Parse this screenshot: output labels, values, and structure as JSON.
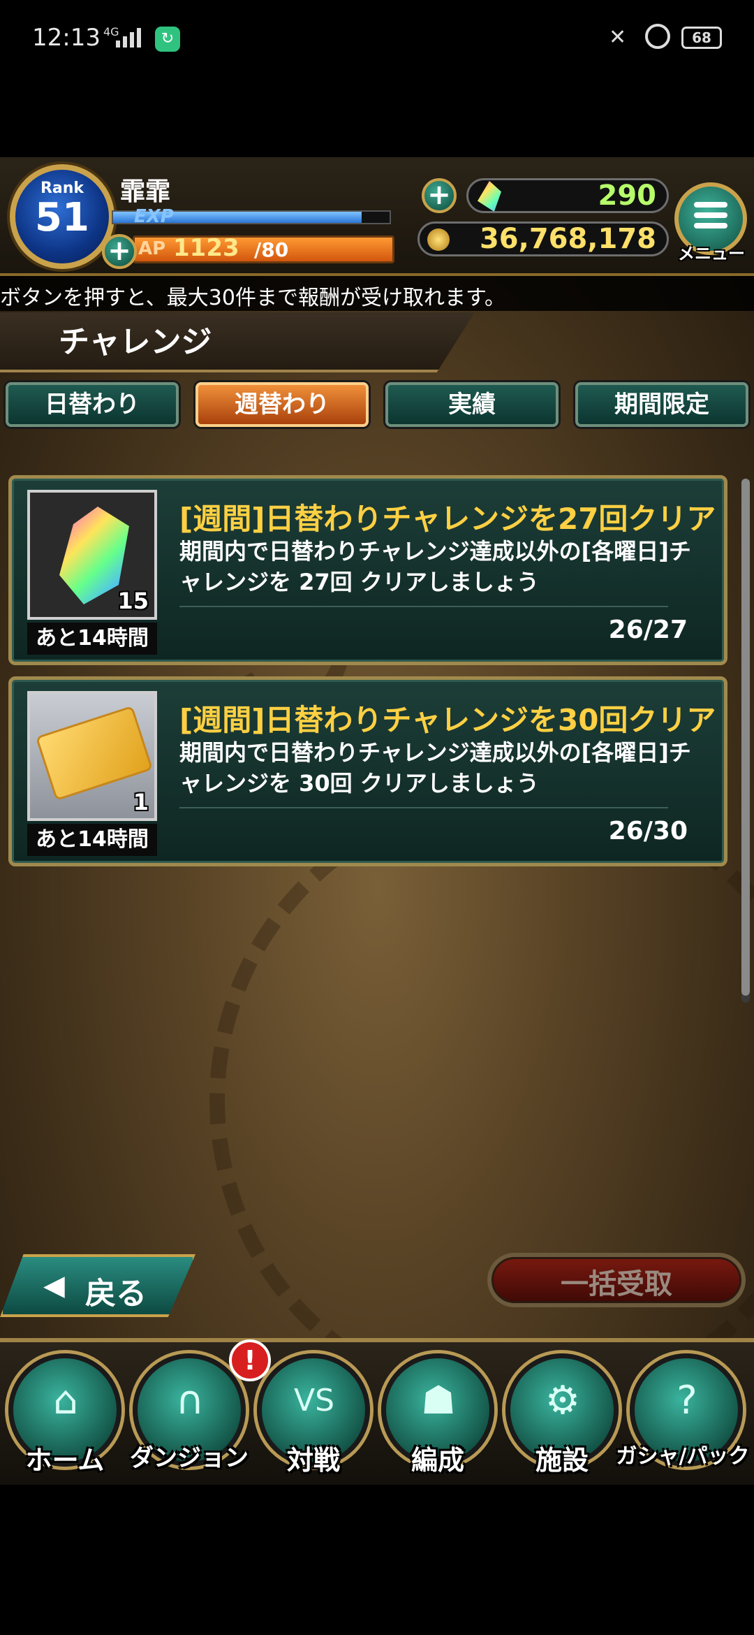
{
  "status_bar": {
    "time": "12:13",
    "network": "4G",
    "battery": "68"
  },
  "header": {
    "rank_label": "Rank",
    "rank": "51",
    "player_name": "霏霏",
    "exp_label": "EXP",
    "exp_progress": 0.9,
    "ap_label": "AP",
    "ap_current": "1123",
    "ap_max": "/80",
    "gems": "290",
    "coins": "36,768,178",
    "menu_label": "メニュー"
  },
  "ticker": "ボタンを押すと、最大30件まで報酬が受け取れます。",
  "page_title": "チャレンジ",
  "tabs": [
    {
      "label": "日替わり",
      "active": false
    },
    {
      "label": "週替わり",
      "active": true
    },
    {
      "label": "実績",
      "active": false
    },
    {
      "label": "期間限定",
      "active": false
    }
  ],
  "missions": [
    {
      "title": "[週間]日替わりチャレンジを27回クリア",
      "description": "期間内で日替わりチャレンジ達成以外の[各曜日]チャレンジを 27回 クリアしましょう",
      "reward_icon": "rainbow-crystal-icon",
      "reward_count": "15",
      "time_left": "あと14時間",
      "progress": "26/27"
    },
    {
      "title": "[週間]日替わりチャレンジを30回クリア",
      "description": "期間内で日替わりチャレンジ達成以外の[各曜日]チャレンジを 30回 クリアしましょう",
      "reward_icon": "bar-ticket-icon",
      "reward_count": "1",
      "time_left": "あと14時間",
      "progress": "26/30"
    }
  ],
  "back_label": "戻る",
  "claim_all_label": "一括受取",
  "nav": [
    {
      "label": "ホーム",
      "icon": "home-icon"
    },
    {
      "label": "ダンジョン",
      "icon": "dungeon-icon",
      "badge": "!"
    },
    {
      "label": "対戦",
      "icon": "versus-icon"
    },
    {
      "label": "編成",
      "icon": "team-icon"
    },
    {
      "label": "施設",
      "icon": "facility-icon"
    },
    {
      "label": "ガシャ/パック",
      "icon": "gacha-icon"
    }
  ],
  "colors": {
    "active_tab": "#e5782a",
    "mission_title": "#ffd043",
    "gem_value": "#b7ff6a",
    "coin_value": "#ffe06a"
  }
}
